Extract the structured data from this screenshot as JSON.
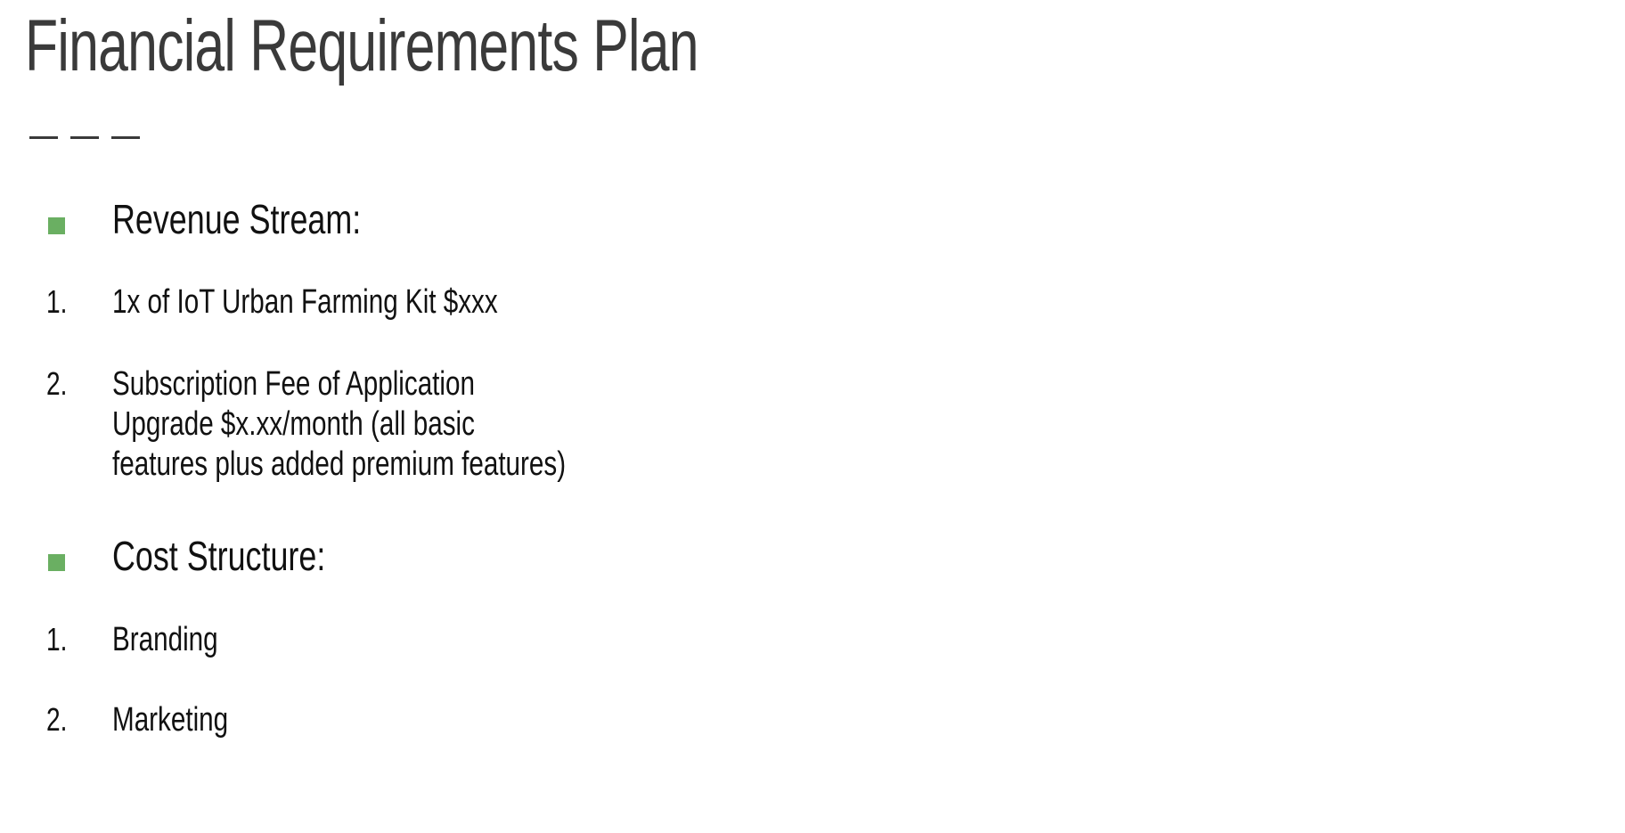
{
  "slide": {
    "title": "Financial Requirements Plan",
    "accent_color": "#6aaf62",
    "title_color": "#3a3a3a",
    "sections": [
      {
        "heading": "Revenue Stream:",
        "bullet_icon": "square-bullet-icon",
        "items": [
          {
            "number": "1.",
            "lines": [
              "1x of IoT Urban Farming Kit $xxx"
            ]
          },
          {
            "number": "2.",
            "lines": [
              "Subscription Fee of Application",
              "Upgrade $x.xx/month (all basic",
              "features plus added premium features)"
            ]
          }
        ]
      },
      {
        "heading": "Cost Structure:",
        "bullet_icon": "square-bullet-icon",
        "items": [
          {
            "number": "1.",
            "lines": [
              "Branding"
            ]
          },
          {
            "number": "2.",
            "lines": [
              "Marketing"
            ]
          }
        ]
      }
    ]
  }
}
